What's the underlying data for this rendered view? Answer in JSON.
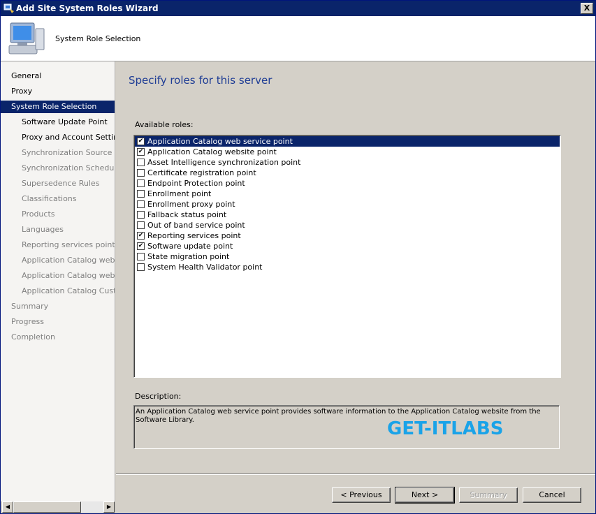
{
  "window": {
    "title": "Add Site System Roles Wizard",
    "close_glyph": "X"
  },
  "header": {
    "page_title": "System Role Selection"
  },
  "nav": {
    "items": [
      {
        "label": "General",
        "state": "done"
      },
      {
        "label": "Proxy",
        "state": "done"
      },
      {
        "label": "System Role Selection",
        "state": "selected"
      },
      {
        "label": "Software Update Point",
        "state": "done"
      },
      {
        "label": "Proxy and Account Settings",
        "state": "done"
      },
      {
        "label": "Synchronization Source",
        "state": "pending"
      },
      {
        "label": "Synchronization Schedule",
        "state": "pending"
      },
      {
        "label": "Supersedence Rules",
        "state": "pending"
      },
      {
        "label": "Classifications",
        "state": "pending"
      },
      {
        "label": "Products",
        "state": "pending"
      },
      {
        "label": "Languages",
        "state": "pending"
      },
      {
        "label": "Reporting services point",
        "state": "pending"
      },
      {
        "label": "Application Catalog web ser",
        "state": "pending"
      },
      {
        "label": "Application Catalog website",
        "state": "pending"
      },
      {
        "label": "Application Catalog Customi",
        "state": "pending"
      },
      {
        "label": "Summary",
        "state": "pending"
      },
      {
        "label": "Progress",
        "state": "pending"
      },
      {
        "label": "Completion",
        "state": "pending"
      }
    ]
  },
  "main": {
    "title": "Specify roles for this server",
    "available_label": "Available roles:",
    "roles": [
      {
        "label": "Application Catalog web service point",
        "checked": true,
        "selected": true
      },
      {
        "label": "Application Catalog website point",
        "checked": true,
        "selected": false
      },
      {
        "label": "Asset Intelligence synchronization point",
        "checked": false,
        "selected": false
      },
      {
        "label": "Certificate registration point",
        "checked": false,
        "selected": false
      },
      {
        "label": "Endpoint Protection point",
        "checked": false,
        "selected": false
      },
      {
        "label": "Enrollment point",
        "checked": false,
        "selected": false
      },
      {
        "label": "Enrollment proxy point",
        "checked": false,
        "selected": false
      },
      {
        "label": "Fallback status point",
        "checked": false,
        "selected": false
      },
      {
        "label": "Out of band service point",
        "checked": false,
        "selected": false
      },
      {
        "label": "Reporting services point",
        "checked": true,
        "selected": false
      },
      {
        "label": "Software update point",
        "checked": true,
        "selected": false
      },
      {
        "label": "State migration point",
        "checked": false,
        "selected": false
      },
      {
        "label": "System Health Validator point",
        "checked": false,
        "selected": false
      }
    ],
    "description_label": "Description:",
    "description_text": "An Application Catalog web service point provides software information to the Application Catalog website from the Software Library.",
    "watermark": "GET-ITLABS"
  },
  "buttons": {
    "previous": "< Previous",
    "next": "Next >",
    "summary": "Summary",
    "cancel": "Cancel"
  }
}
